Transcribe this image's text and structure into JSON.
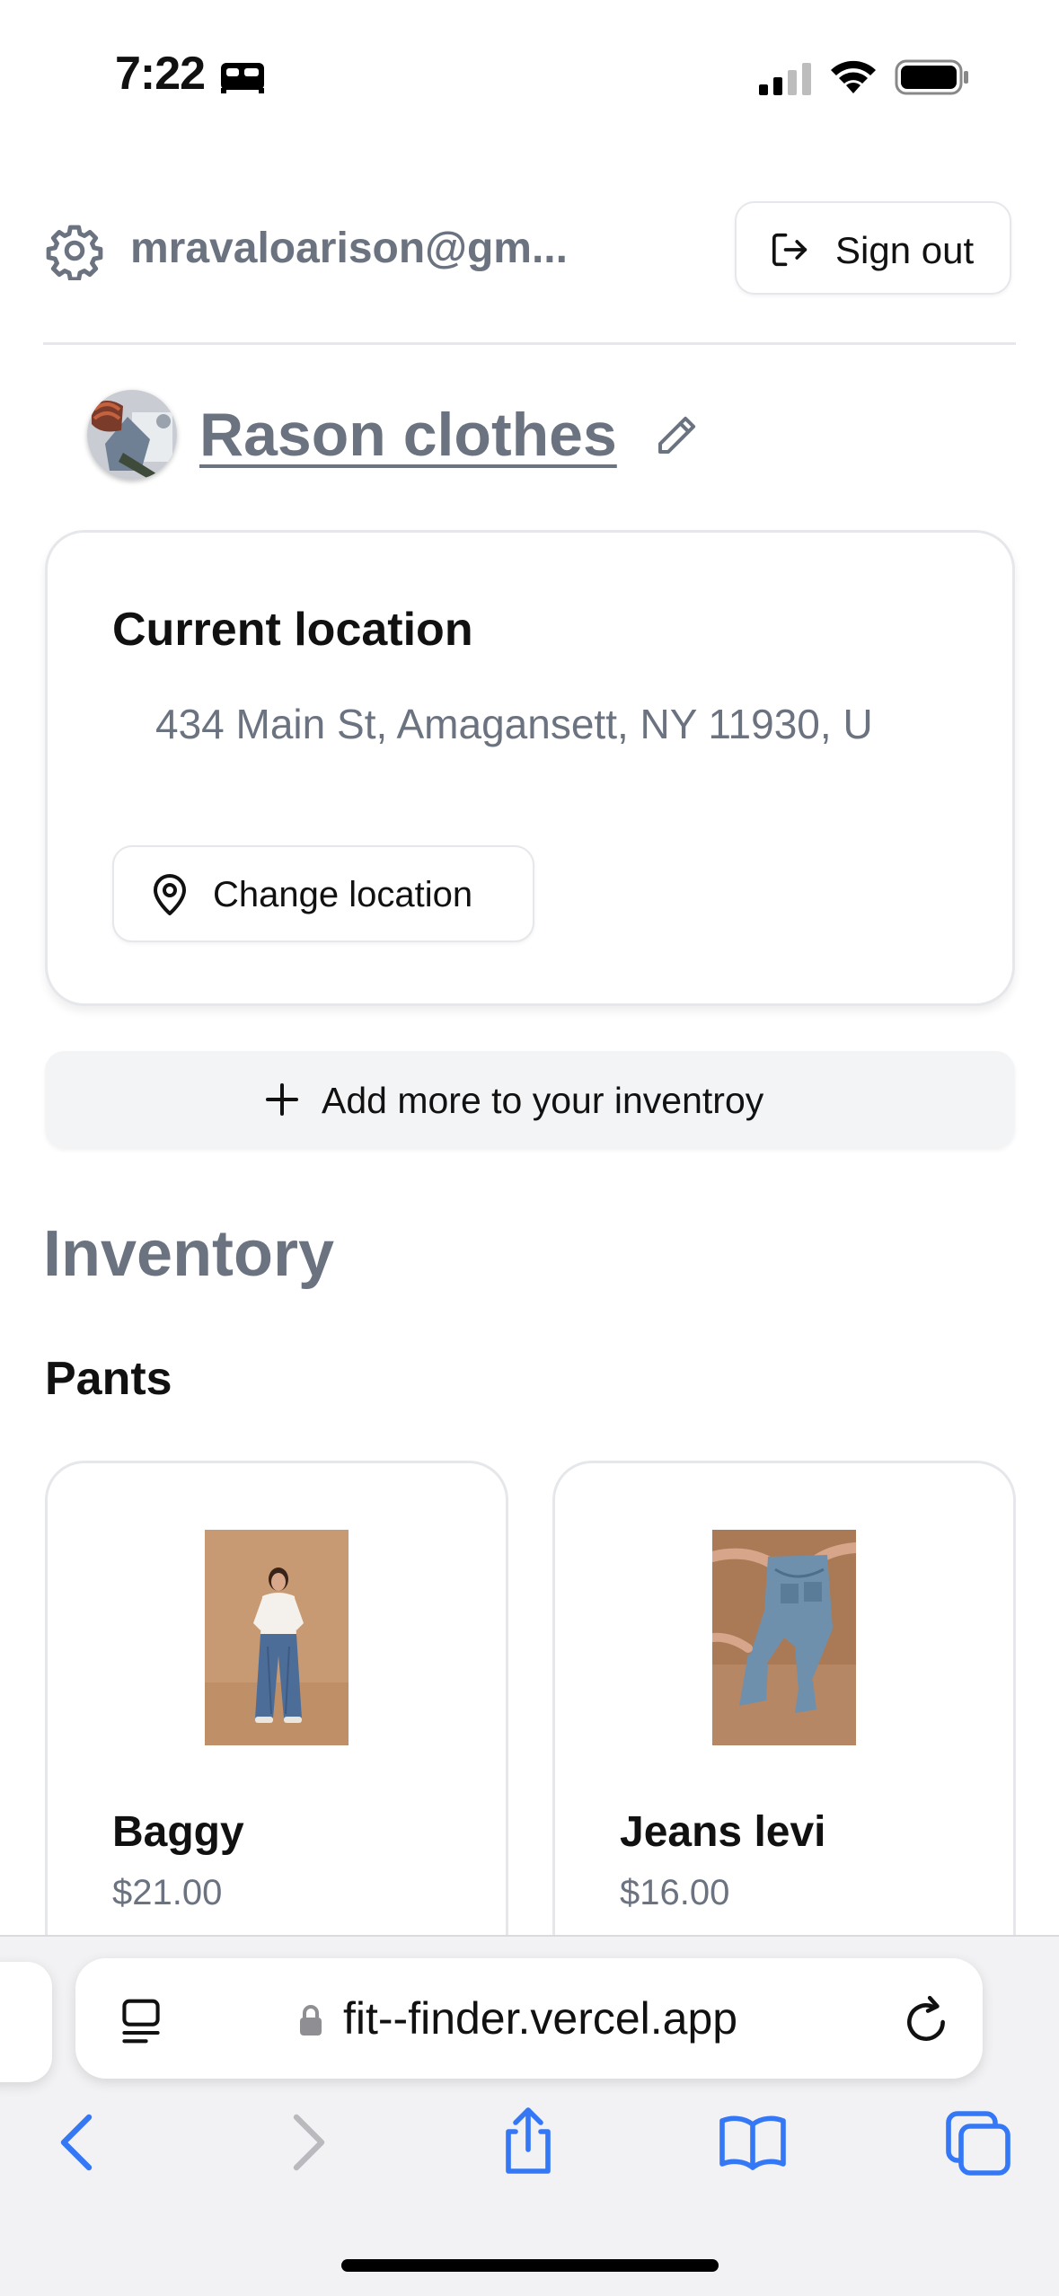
{
  "status_bar": {
    "time": "7:22"
  },
  "header": {
    "user_email": "mravaloarison@gm...",
    "sign_out_label": "Sign out"
  },
  "store": {
    "name": "Rason clothes"
  },
  "location": {
    "title": "Current location",
    "address": "434 Main St, Amagansett, NY 11930, U",
    "change_label": "Change location"
  },
  "add_inventory": {
    "label": "Add more to your inventroy"
  },
  "inventory": {
    "heading": "Inventory",
    "categories": [
      {
        "name": "Pants",
        "items": [
          {
            "name": "Baggy",
            "price": "$21.00"
          },
          {
            "name": "Jeans levi",
            "price": "$16.00"
          }
        ]
      }
    ]
  },
  "browser": {
    "url": "fit--finder.vercel.app",
    "icons": [
      "reader-icon",
      "lock-icon",
      "reload-icon",
      "back-icon",
      "forward-icon",
      "share-icon",
      "bookmarks-icon",
      "tabs-icon"
    ]
  },
  "colors": {
    "muted_text": "#6b7280",
    "border": "#e5e7eb",
    "safari_blue": "#3478f6",
    "disabled_gray": "#b9b9be"
  }
}
